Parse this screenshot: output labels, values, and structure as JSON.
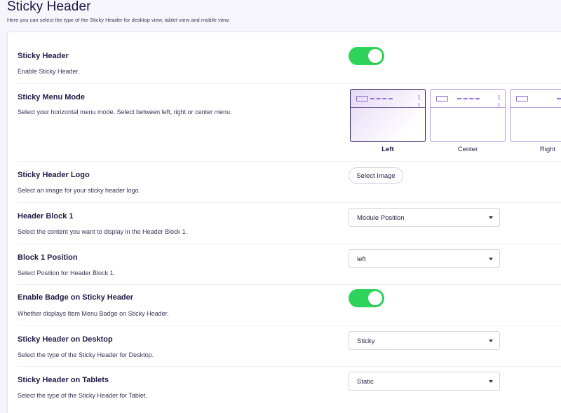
{
  "page": {
    "title": "Sticky Header",
    "subtitle": "Here you can select the type of the Sticky Header for desktop view, tablet view and mobile view."
  },
  "colors": {
    "toggle_on": "#2ed35b",
    "accent": "#9a6fe0",
    "heading": "#211a45"
  },
  "settings": {
    "sticky_header": {
      "label": "Sticky Header",
      "desc": "Enable Sticky Header.",
      "enabled": true
    },
    "menu_mode": {
      "label": "Sticky Menu Mode",
      "desc": "Select your horizontal menu mode. Select between left, right or center menu.",
      "selected": "Left",
      "options": [
        {
          "label": "Left",
          "badge": "1"
        },
        {
          "label": "Center",
          "badge": "1"
        },
        {
          "label": "Right",
          "badge": "1"
        }
      ]
    },
    "logo": {
      "label": "Sticky Header Logo",
      "desc": "Select an image for your sticky header logo.",
      "button": "Select Image"
    },
    "header_block_1": {
      "label": "Header Block 1",
      "desc": "Select the content you want to display in the Header Block 1.",
      "value": "Module Position"
    },
    "block_1_position": {
      "label": "Block 1 Position",
      "desc": "Select Position for Header Block 1.",
      "value": "left"
    },
    "badge": {
      "label": "Enable Badge on Sticky Header",
      "desc": "Whether displays Item Menu Badge on Sticky Header.",
      "enabled": true
    },
    "desktop": {
      "label": "Sticky Header on Desktop",
      "desc": "Select the type of the Sticky Header for Desktop.",
      "value": "Sticky"
    },
    "tablets": {
      "label": "Sticky Header on Tablets",
      "desc": "Select the type of the Sticky Header for Tablet.",
      "value": "Static"
    }
  }
}
